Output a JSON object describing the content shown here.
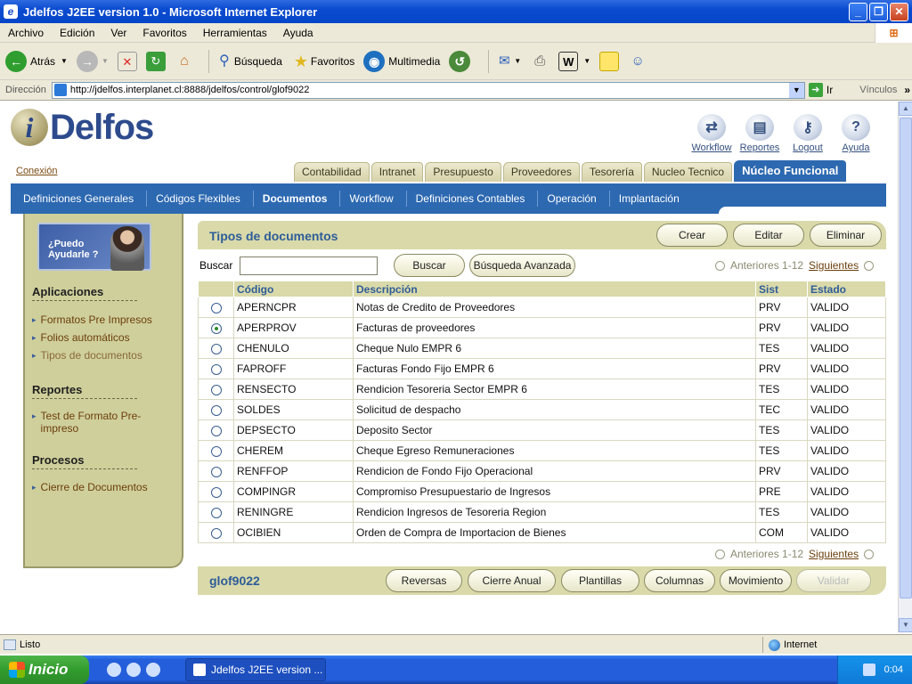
{
  "window": {
    "title": "Jdelfos J2EE version 1.0 - Microsoft Internet Explorer"
  },
  "menu": [
    "Archivo",
    "Edición",
    "Ver",
    "Favoritos",
    "Herramientas",
    "Ayuda"
  ],
  "toolbar": {
    "back": "Atrás",
    "search": "Búsqueda",
    "favorites": "Favoritos",
    "media": "Multimedia"
  },
  "address": {
    "label": "Dirección",
    "url": "http://jdelfos.interplanet.cl:8888/jdelfos/control/glof9022",
    "go": "Ir",
    "links": "Vínculos"
  },
  "app": {
    "logo_text": "Delfos",
    "logo_i": "i",
    "global_links": [
      {
        "label": "Workflow",
        "icon": "workflow-icon"
      },
      {
        "label": "Reportes",
        "icon": "reports-icon"
      },
      {
        "label": "Logout",
        "icon": "key-icon"
      },
      {
        "label": "Ayuda",
        "icon": "help-icon"
      }
    ],
    "conexion": "Conexión",
    "tabs": [
      "Contabilidad",
      "Intranet",
      "Presupuesto",
      "Proveedores",
      "Tesorería",
      "Nucleo Tecnico",
      "Núcleo Funcional"
    ],
    "active_tab": "Núcleo Funcional",
    "subnav": [
      "Definiciones Generales",
      "Códigos Flexibles",
      "Documentos",
      "Workflow",
      "Definiciones Contables",
      "Operación",
      "Implantación"
    ],
    "active_subnav": "Documentos"
  },
  "sidebar": {
    "help_banner": "¿Puedo Ayudarle ?",
    "sections": [
      {
        "title": "Aplicaciones",
        "items": [
          "Formatos Pre Impresos",
          "Folios automáticos",
          "Tipos de documentos"
        ]
      },
      {
        "title": "Reportes",
        "items": [
          "Test de Formato Pre-impreso"
        ]
      },
      {
        "title": "Procesos",
        "items": [
          "Cierre de Documentos"
        ]
      }
    ]
  },
  "main": {
    "title": "Tipos de documentos",
    "actions": [
      "Crear",
      "Editar",
      "Eliminar"
    ],
    "search_label": "Buscar",
    "search_value": "",
    "search_button": "Buscar",
    "advanced_button": "Búsqueda Avanzada",
    "pager": {
      "prev": "Anteriores 1-12",
      "next": "Siguientes"
    },
    "columns": [
      "Código",
      "Descripción",
      "Sist",
      "Estado"
    ],
    "selected_row": 1,
    "rows": [
      [
        "APERNCPR",
        "Notas de Credito de Proveedores",
        "PRV",
        "VALIDO"
      ],
      [
        "APERPROV",
        "Facturas de proveedores",
        "PRV",
        "VALIDO"
      ],
      [
        "CHENULO",
        "Cheque Nulo EMPR 6",
        "TES",
        "VALIDO"
      ],
      [
        "FAPROFF",
        "Facturas Fondo Fijo EMPR 6",
        "PRV",
        "VALIDO"
      ],
      [
        "RENSECTO",
        "Rendicion Tesoreria Sector EMPR 6",
        "TES",
        "VALIDO"
      ],
      [
        "SOLDES",
        "Solicitud de despacho",
        "TEC",
        "VALIDO"
      ],
      [
        "DEPSECTO",
        "Deposito Sector",
        "TES",
        "VALIDO"
      ],
      [
        "CHEREM",
        "Cheque Egreso Remuneraciones",
        "TES",
        "VALIDO"
      ],
      [
        "RENFFOP",
        "Rendicion de Fondo Fijo Operacional",
        "PRV",
        "VALIDO"
      ],
      [
        "COMPINGR",
        "Compromiso Presupuestario de Ingresos",
        "PRE",
        "VALIDO"
      ],
      [
        "RENINGRE",
        "Rendicion Ingresos de Tesoreria Region",
        "TES",
        "VALIDO"
      ],
      [
        "OCIBIEN",
        "Orden de Compra de Importacion de Bienes",
        "COM",
        "VALIDO"
      ]
    ],
    "footer_code": "glof9022",
    "footer_buttons": [
      "Reversas",
      "Cierre Anual",
      "Plantillas",
      "Columnas",
      "Movimiento",
      "Validar"
    ]
  },
  "statusbar": {
    "text": "Listo",
    "zone": "Internet"
  },
  "taskbar": {
    "start": "Inicio",
    "task": "Jdelfos J2EE version ...",
    "clock": "0:04"
  }
}
